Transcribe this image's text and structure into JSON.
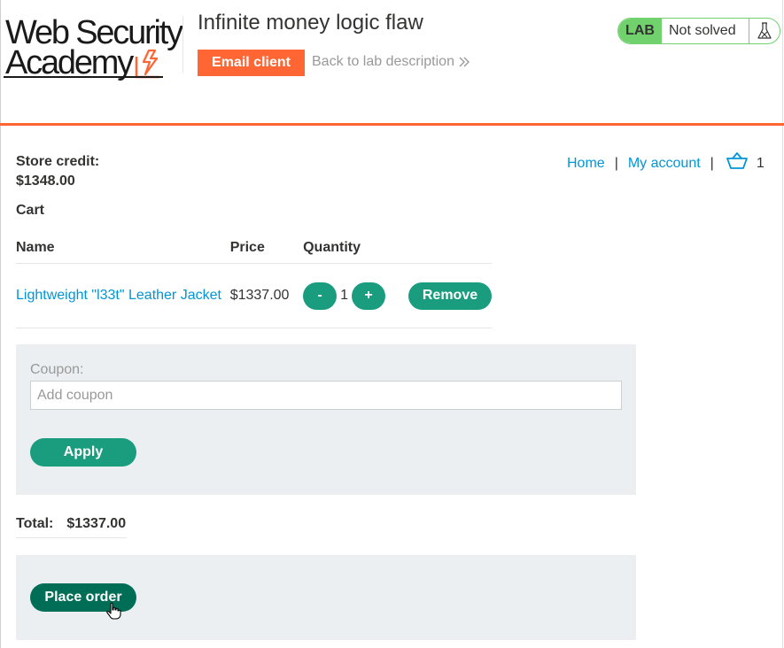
{
  "header": {
    "logo_line1": "Web Security",
    "logo_line2": "Academy",
    "lab_title": "Infinite money logic flaw",
    "email_client_label": "Email client",
    "back_link_label": "Back to lab description",
    "lab_badge": {
      "tag": "LAB",
      "status": "Not solved",
      "icon": "flask-icon"
    }
  },
  "store": {
    "credit_label": "Store credit:",
    "credit_value": "$1348.00"
  },
  "nav": {
    "home": "Home",
    "separator": "|",
    "my_account": "My account",
    "cart_icon": "basket-icon",
    "cart_count": "1"
  },
  "cart": {
    "heading": "Cart",
    "columns": [
      "Name",
      "Price",
      "Quantity"
    ],
    "items": [
      {
        "name": "Lightweight \"l33t\" Leather Jacket",
        "price": "$1337.00",
        "decrement_label": "-",
        "quantity": "1",
        "increment_label": "+",
        "remove_label": "Remove"
      }
    ]
  },
  "coupon": {
    "label": "Coupon:",
    "value": "",
    "placeholder": "Add coupon",
    "apply_label": "Apply"
  },
  "total": {
    "label": "Total:",
    "value": "$1337.00"
  },
  "order": {
    "place_order_label": "Place order"
  },
  "colors": {
    "brand_orange": "#ff6633",
    "action_green": "#1a9d7f",
    "place_order_green": "#006e56",
    "lab_green": "#70d16d",
    "link_blue": "#0096d6",
    "panel_gray": "#ebeff2"
  }
}
